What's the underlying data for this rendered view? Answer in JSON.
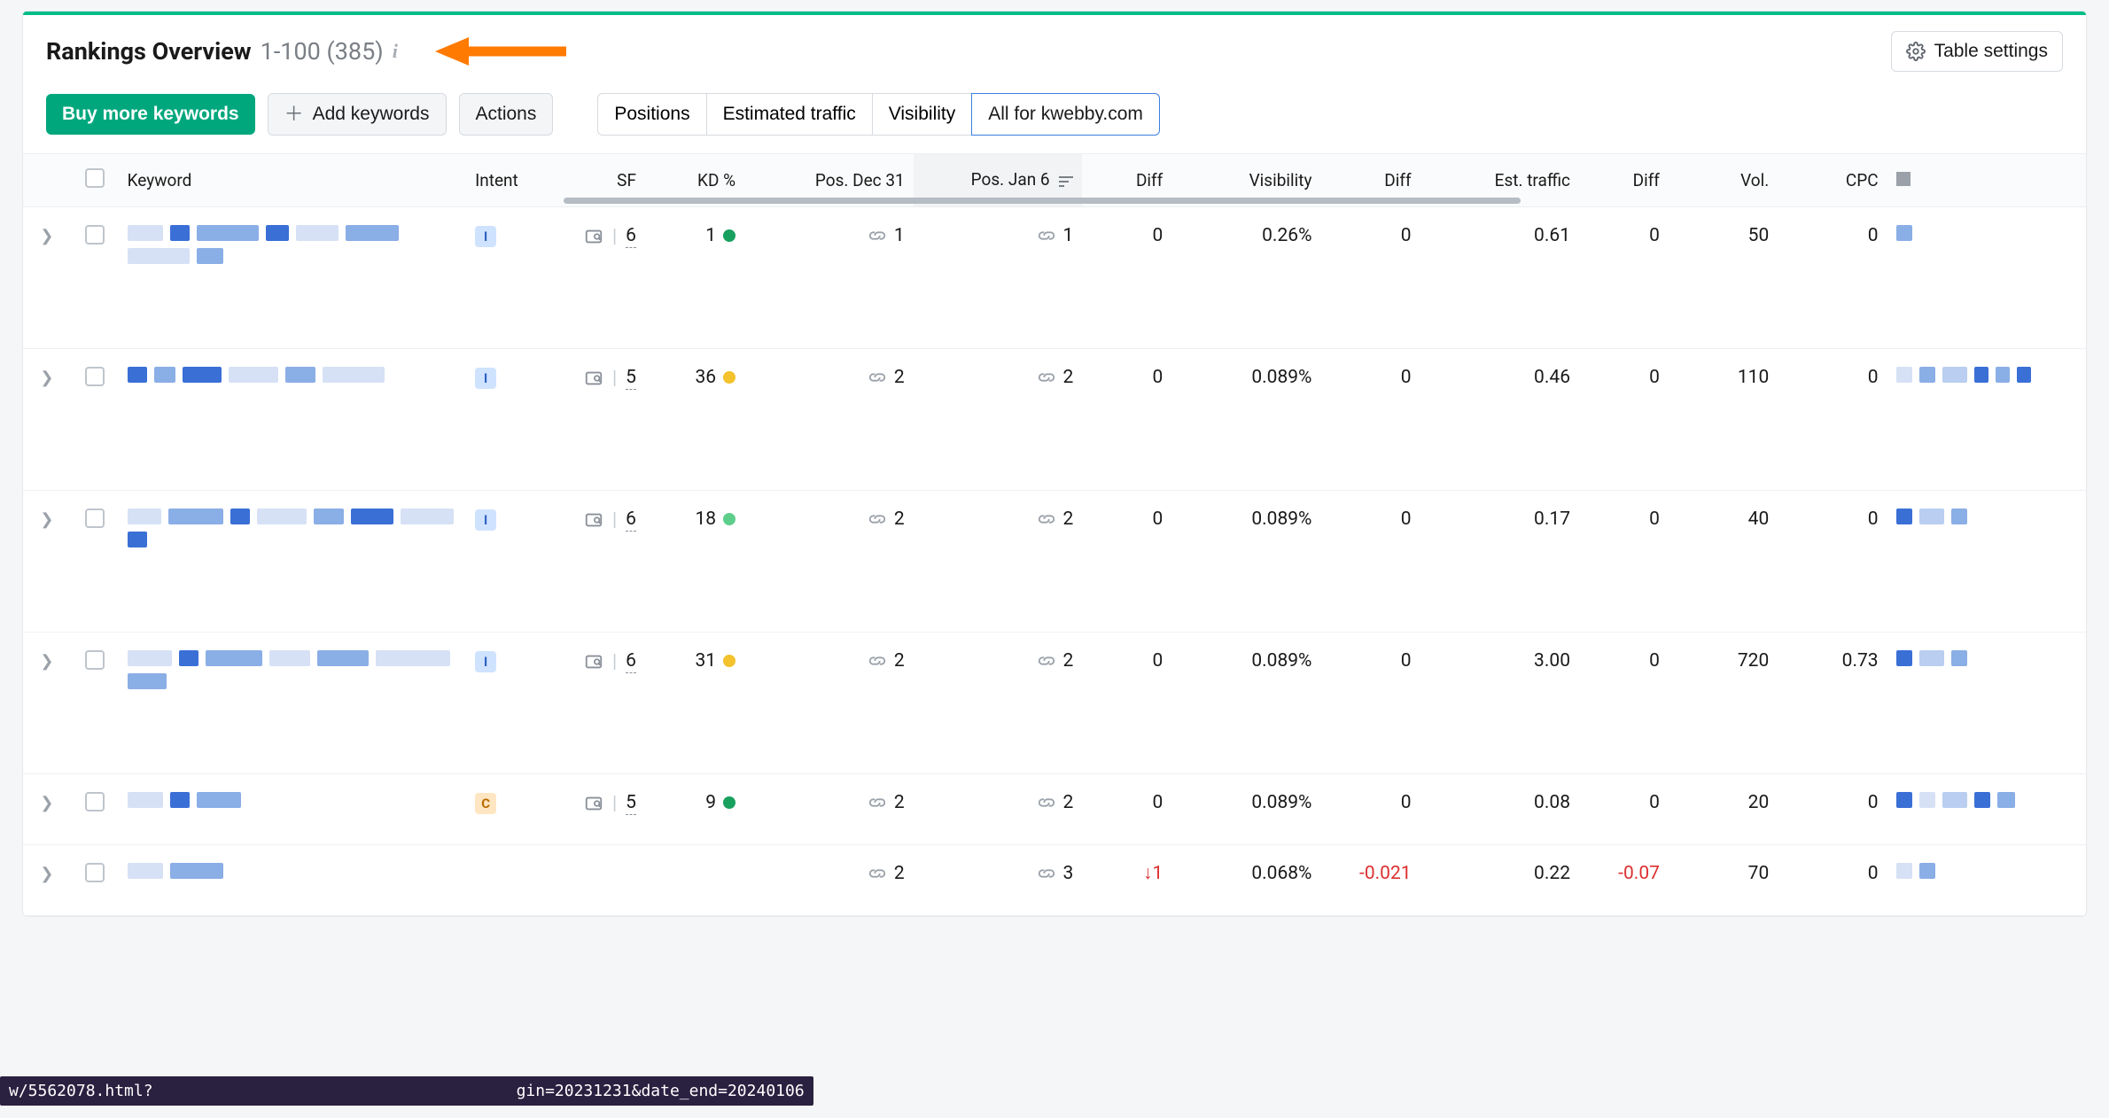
{
  "header": {
    "title": "Rankings Overview",
    "range": "1-100",
    "total": "(385)"
  },
  "settings_btn": "Table settings",
  "toolbar": {
    "buy": "Buy more keywords",
    "add": "Add keywords",
    "actions": "Actions"
  },
  "tabs": [
    "Positions",
    "Estimated traffic",
    "Visibility",
    "All for kwebby.com"
  ],
  "active_tab": 3,
  "columns": {
    "keyword": "Keyword",
    "intent": "Intent",
    "sf": "SF",
    "kd": "KD %",
    "pos1": "Pos. Dec 31",
    "pos2": "Pos. Jan 6",
    "diff1": "Diff",
    "visibility": "Visibility",
    "diff2": "Diff",
    "traffic": "Est. traffic",
    "diff3": "Diff",
    "vol": "Vol.",
    "cpc": "CPC"
  },
  "rows": [
    {
      "intent": "I",
      "sf": "6",
      "kd": "1",
      "kd_dot": "green",
      "p1": "1",
      "p2": "1",
      "d1": "0",
      "vis": "0.26%",
      "d2": "0",
      "tr": "0.61",
      "d3": "0",
      "vol": "50",
      "cpc": "0"
    },
    {
      "intent": "I",
      "sf": "5",
      "kd": "36",
      "kd_dot": "yellow",
      "p1": "2",
      "p2": "2",
      "d1": "0",
      "vis": "0.089%",
      "d2": "0",
      "tr": "0.46",
      "d3": "0",
      "vol": "110",
      "cpc": "0"
    },
    {
      "intent": "I",
      "sf": "6",
      "kd": "18",
      "kd_dot": "lgreen",
      "p1": "2",
      "p2": "2",
      "d1": "0",
      "vis": "0.089%",
      "d2": "0",
      "tr": "0.17",
      "d3": "0",
      "vol": "40",
      "cpc": "0"
    },
    {
      "intent": "I",
      "sf": "6",
      "kd": "31",
      "kd_dot": "yellow",
      "p1": "2",
      "p2": "2",
      "d1": "0",
      "vis": "0.089%",
      "d2": "0",
      "tr": "3.00",
      "d3": "0",
      "vol": "720",
      "cpc": "0.73"
    },
    {
      "intent": "C",
      "sf": "5",
      "kd": "9",
      "kd_dot": "green",
      "p1": "2",
      "p2": "2",
      "d1": "0",
      "vis": "0.089%",
      "d2": "0",
      "tr": "0.08",
      "d3": "0",
      "vol": "20",
      "cpc": "0"
    },
    {
      "intent": "",
      "sf": "",
      "kd": "",
      "kd_dot": "",
      "p1": "2",
      "p2": "3",
      "d1": "↓1",
      "vis": "0.068%",
      "d2": "-0.021",
      "tr": "0.22",
      "d3": "-0.07",
      "vol": "70",
      "cpc": "0"
    }
  ],
  "status": {
    "left": "w/5562078.html?",
    "right": "gin=20231231&date_end=20240106"
  }
}
